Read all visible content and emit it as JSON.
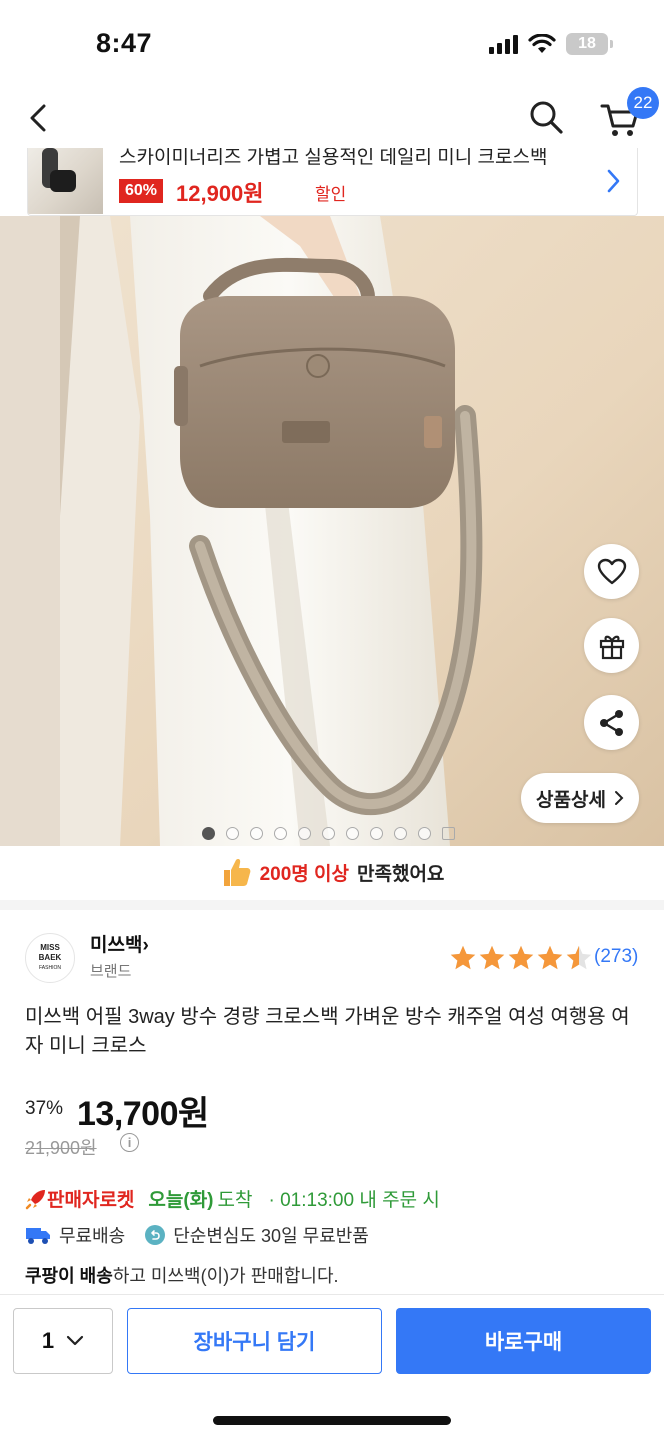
{
  "status_bar": {
    "time": "8:47",
    "battery": "18"
  },
  "nav": {
    "cart_count": "22"
  },
  "promo": {
    "title": "스카이미너리즈 가볍고 실용적인 데일리 미니 크로스백",
    "discount": "60%",
    "price": "12,900원",
    "sale_label": "할인"
  },
  "gallery": {
    "detail_button": "상품상세",
    "total_images": 10,
    "active_index": 0
  },
  "satisfaction": {
    "highlight": "200명 이상",
    "rest": "만족했어요"
  },
  "brand": {
    "logo_line1": "MISS",
    "logo_line2": "BAEK",
    "logo_line3": "FASHION",
    "name": "미쓰백",
    "type": "브랜드",
    "rating": 4.5,
    "review_count": "(273)"
  },
  "product": {
    "title": "미쓰백 어필 3way 방수 경량 크로스백 가벼운 방수 캐주얼 여성 여행용 여자 미니 크로스",
    "discount_rate": "37%",
    "sale_price": "13,700원",
    "original_price": "21,900원"
  },
  "delivery": {
    "rocket_label": "판매자로켓",
    "arrive_day": "오늘(화)",
    "arrive_word": "도착",
    "cutoff": "· 01:13:00  내 주문 시"
  },
  "shipping": {
    "free_shipping": "무료배송",
    "return_policy": "단순변심도 30일 무료반품"
  },
  "seller": {
    "bold": "쿠팡이 배송",
    "rest": "하고 미쓰백(이)가 판매합니다."
  },
  "bottom": {
    "quantity": "1",
    "cart_button": "장바구니 담기",
    "buy_button": "바로구매"
  },
  "colors": {
    "accent_blue": "#3478f6",
    "sale_red": "#e0261f",
    "arrive_green": "#2f9a38",
    "star_orange": "#f5973a"
  },
  "icons": [
    "back-icon",
    "search-icon",
    "cart-icon",
    "chevron-right-icon",
    "heart-icon",
    "gift-icon",
    "share-icon",
    "thumbs-up-icon",
    "info-icon",
    "truck-icon",
    "return-icon",
    "rocket-icon",
    "chevron-down-icon"
  ]
}
